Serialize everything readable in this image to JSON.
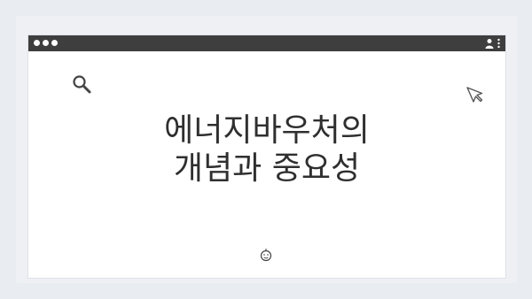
{
  "slide": {
    "title_line1": "에너지바우처의",
    "title_line2": "개념과 중요성"
  },
  "icons": {
    "titlebar_left": "window-control-dots",
    "titlebar_right": [
      "user-icon",
      "more-vertical-icon"
    ],
    "decor": [
      "search-icon",
      "cursor-arrow-icon",
      "smiley-face-icon",
      "carousel-dots"
    ]
  },
  "colors": {
    "background": "#e9ecf1",
    "titlebar": "#3e3e3e",
    "text": "#2f2f2f",
    "icon_stroke": "#444444"
  }
}
